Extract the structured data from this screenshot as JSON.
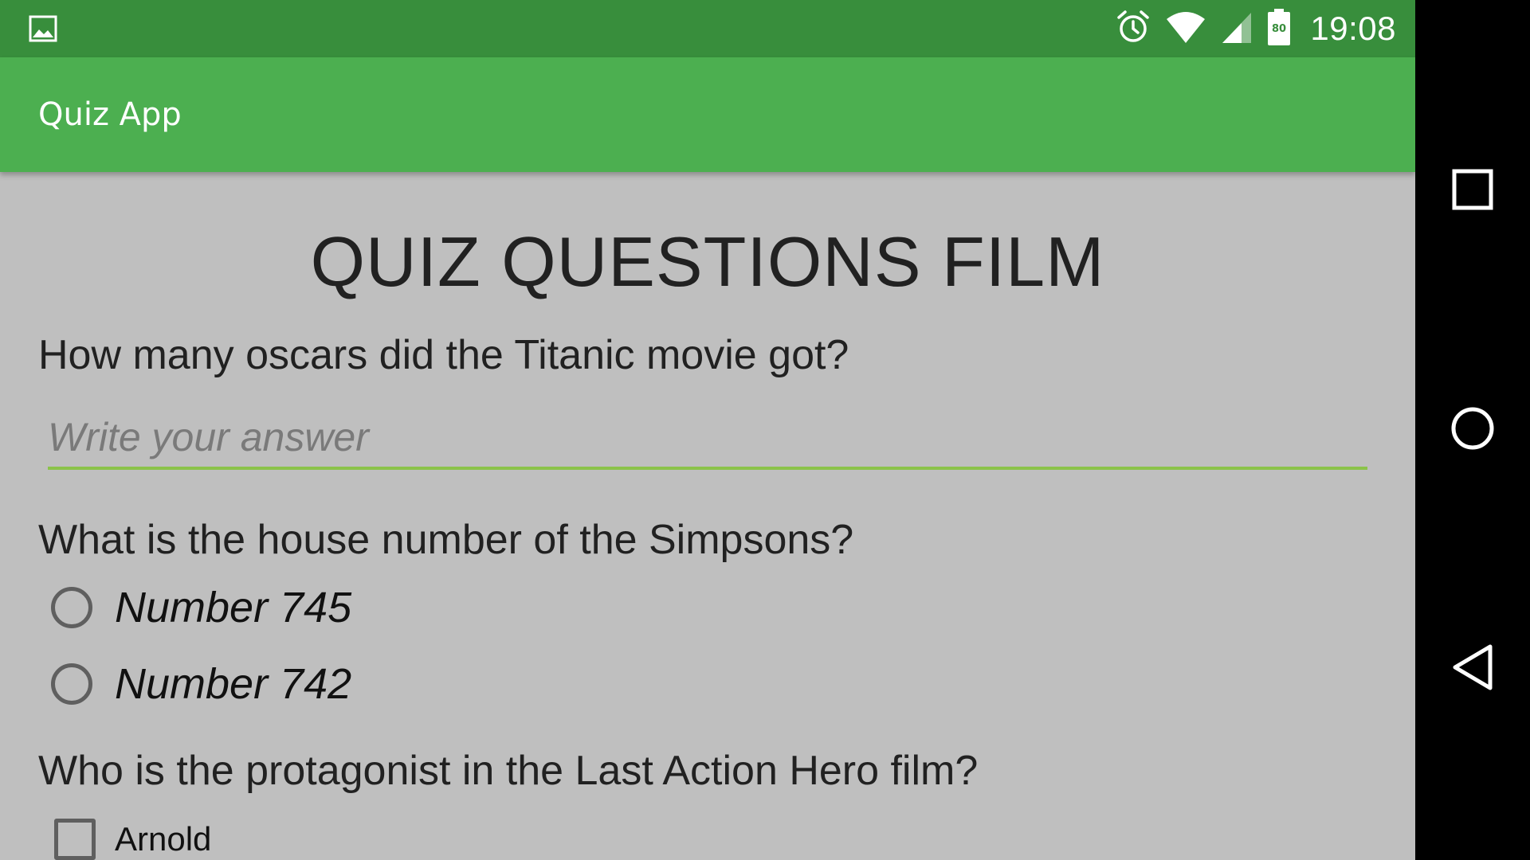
{
  "status_bar": {
    "time": "19:08",
    "battery_level": "80"
  },
  "app_bar": {
    "title": "Quiz App"
  },
  "main": {
    "heading": "QUIZ QUESTIONS FILM",
    "question1": {
      "text": "How many oscars did the Titanic movie got?",
      "placeholder": "Write your answer",
      "value": ""
    },
    "question2": {
      "text": "What is the house number of the Simpsons?",
      "options": [
        "Number 745",
        "Number 742"
      ]
    },
    "question3": {
      "text": "Who is the protagonist in the Last Action Hero film?",
      "options": [
        "Arnold"
      ]
    }
  },
  "colors": {
    "status_bar": "#388e3c",
    "app_bar": "#4caf50",
    "accent_underline": "#8bc34a",
    "background": "#bfbfbf"
  },
  "icons": {
    "status_left": "image-icon",
    "status_right": [
      "alarm-icon",
      "wifi-icon",
      "cell-signal-icon",
      "battery-icon"
    ],
    "nav": [
      "recent-apps-icon",
      "home-icon",
      "back-icon"
    ]
  }
}
